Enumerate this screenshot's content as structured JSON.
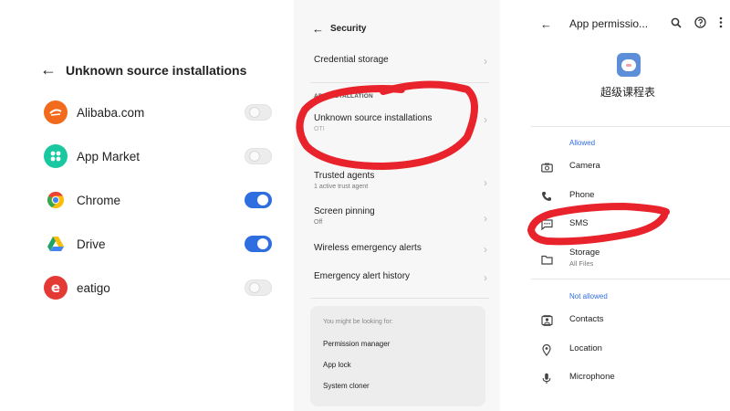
{
  "panel1": {
    "title": "Unknown source installations",
    "apps": [
      {
        "name": "Alibaba.com",
        "enabled": false,
        "icon": "alibaba-icon",
        "color": "#f26a1b"
      },
      {
        "name": "App Market",
        "enabled": false,
        "icon": "app-market-icon",
        "color": "#19c8a0"
      },
      {
        "name": "Chrome",
        "enabled": true,
        "icon": "chrome-icon",
        "color": "#4285f4"
      },
      {
        "name": "Drive",
        "enabled": true,
        "icon": "drive-icon",
        "color": "#1fa463"
      },
      {
        "name": "eatigo",
        "enabled": false,
        "icon": "eatigo-icon",
        "color": "#e53935"
      }
    ]
  },
  "panel2": {
    "title": "Security",
    "credential_storage": "Credential storage",
    "section_app_installation": "APP INSTALLATION",
    "unknown_sources": "Unknown source installations",
    "partial_label": "OTI",
    "trusted_agents": "Trusted agents",
    "trusted_agents_sub": "1 active trust agent",
    "screen_pinning": "Screen pinning",
    "screen_pinning_sub": "Off",
    "wireless_alerts": "Wireless emergency alerts",
    "emergency_history": "Emergency alert history",
    "suggest_head": "You might be looking for:",
    "suggestions": [
      "Permission manager",
      "App lock",
      "System cloner"
    ]
  },
  "panel3": {
    "title": "App permissio...",
    "app_name": "超级课程表",
    "allowed_label": "Allowed",
    "not_allowed_label": "Not allowed",
    "allowed": [
      {
        "name": "Camera",
        "sub": "",
        "icon": "camera-icon"
      },
      {
        "name": "Phone",
        "sub": "",
        "icon": "phone-icon"
      },
      {
        "name": "SMS",
        "sub": "",
        "icon": "sms-icon"
      },
      {
        "name": "Storage",
        "sub": "All Files",
        "icon": "folder-icon"
      }
    ],
    "not_allowed": [
      {
        "name": "Contacts",
        "icon": "contacts-icon"
      },
      {
        "name": "Location",
        "icon": "location-icon"
      },
      {
        "name": "Microphone",
        "icon": "microphone-icon"
      }
    ]
  },
  "colors": {
    "accent": "#2f6ee0",
    "annotation": "#e8232b"
  }
}
